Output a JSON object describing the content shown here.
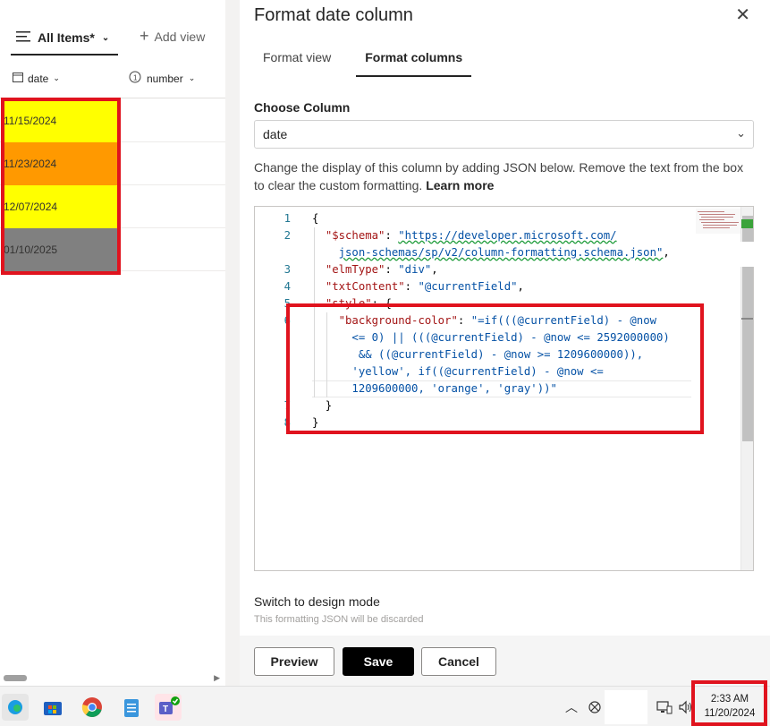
{
  "list": {
    "view_label": "All Items*",
    "add_view_label": "Add view",
    "columns": [
      "date",
      "number"
    ],
    "rows": [
      {
        "date": "11/15/2024",
        "color": "#ffff00"
      },
      {
        "date": "11/23/2024",
        "color": "#ff9900"
      },
      {
        "date": "12/07/2024",
        "color": "#ffff00"
      },
      {
        "date": "01/10/2025",
        "color": "#808080"
      }
    ]
  },
  "panel": {
    "title": "Format date column",
    "tabs": [
      "Format view",
      "Format columns"
    ],
    "active_tab": "Format columns",
    "choose_label": "Choose Column",
    "column_value": "date",
    "description": "Change the display of this column by adding JSON below. Remove the text from the box to clear the custom formatting.",
    "learn_more": "Learn more",
    "switch_label": "Switch to design mode",
    "switch_note": "This formatting JSON will be discarded",
    "buttons": {
      "preview": "Preview",
      "save": "Save",
      "cancel": "Cancel"
    }
  },
  "code": {
    "line_numbers": [
      "1",
      "2",
      "3",
      "4",
      "5",
      "6",
      "7",
      "8"
    ]
  },
  "taskbar": {
    "time": "2:33 AM",
    "date": "11/20/2024"
  }
}
